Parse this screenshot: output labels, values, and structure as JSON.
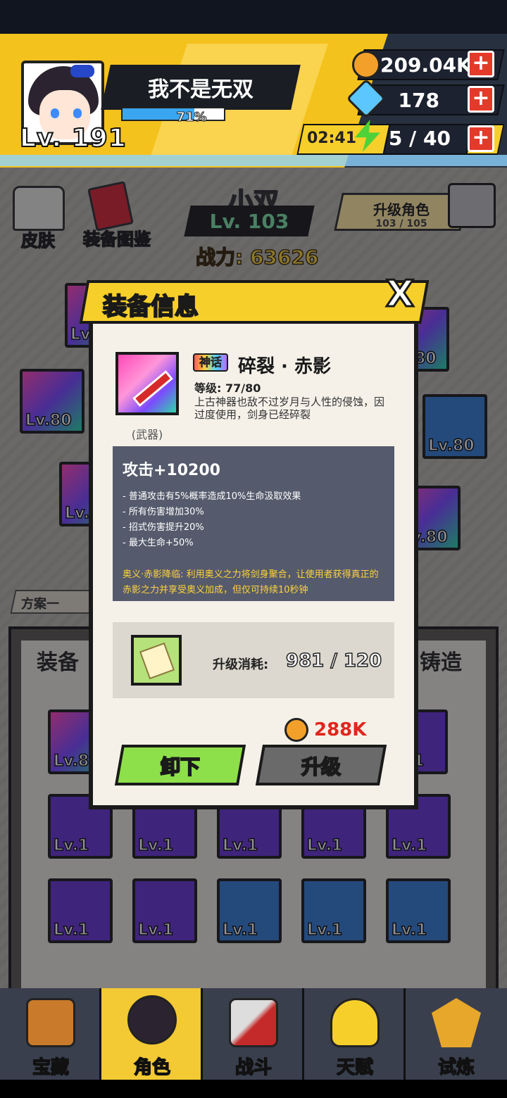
{
  "player": {
    "name": "我不是无双",
    "level": "Lv. 191",
    "exp_percent": "71%",
    "exp_fraction": 0.71
  },
  "resources": {
    "gold": "209.04K",
    "gems": "178",
    "energy_timer": "02:41",
    "energy": "5 / 40",
    "plus": "+"
  },
  "side_buttons": {
    "skin": "皮肤",
    "codex": "装备图鉴"
  },
  "hero": {
    "name": "小双",
    "level": "Lv. 103",
    "power": "战力: 63626"
  },
  "upgrade_role": {
    "label": "升级角色",
    "count": "103 / 105"
  },
  "background_slots": [
    "Lv.80",
    "Lv.80",
    "Lv.80",
    "Lv.80",
    "Lv.80",
    "Lv.80"
  ],
  "plan_tab": "方案一",
  "equip_tab": "装备",
  "forge_tab": "铸造",
  "grid_slots": [
    "Lv.8",
    "Lv.1",
    "Lv.1",
    "Lv.1",
    "Lv.1",
    "Lv.1",
    "Lv.1",
    "Lv.1",
    "Lv.1",
    "Lv.1",
    "Lv.1",
    "Lv.1"
  ],
  "modal": {
    "title": "装备信息",
    "close": "X",
    "rarity": "神话",
    "item_name": "碎裂 · 赤影",
    "item_level": "等级: 77/80",
    "item_desc": "上古神器也敌不过岁月与人性的侵蚀，因过度使用，剑身已经碎裂",
    "item_type": "(武器)",
    "main_stat": "攻击+10200",
    "stat_lines": [
      "- 普通攻击有5%概率造成10%生命汲取效果",
      "- 所有伤害增加30%",
      "- 招式伤害提升20%",
      "- 最大生命+50%"
    ],
    "special": "奥义·赤影降临: 利用奥义之力将剑身聚合，让使用者获得真正的赤影之力并享受奥义加成，但仅可持续10秒钟",
    "cost_label": "升级消耗:",
    "cost_value": "981 / 120",
    "gold_cost": "288K",
    "unequip": "卸下",
    "upgrade": "升级"
  },
  "nav": [
    {
      "label": "宝藏",
      "icon": "treasure-chest-icon"
    },
    {
      "label": "角色",
      "icon": "character-icon"
    },
    {
      "label": "战斗",
      "icon": "battle-swords-icon"
    },
    {
      "label": "天赋",
      "icon": "lightbulb-icon"
    },
    {
      "label": "试炼",
      "icon": "trial-emblem-icon"
    }
  ],
  "colors": {
    "accent_yellow": "#f7cf2a",
    "unequip_green": "#8ee04a",
    "price_red": "#e0261e",
    "special_text": "#ffd23c"
  }
}
